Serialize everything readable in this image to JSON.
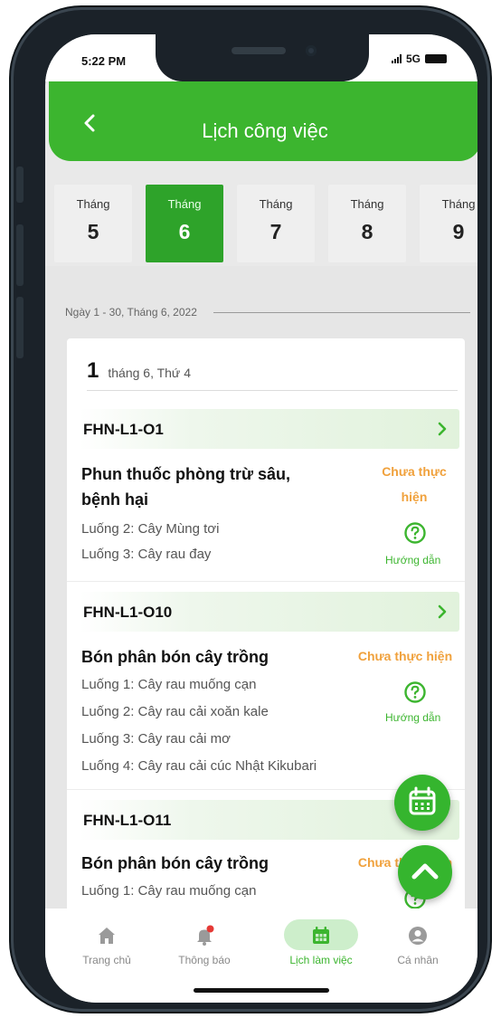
{
  "status_bar": {
    "time": "5:22 PM",
    "network": "5G"
  },
  "header": {
    "title": "Lịch công việc",
    "back_icon": "chevron-left-icon"
  },
  "months": [
    {
      "label": "Tháng",
      "number": "5",
      "active": false
    },
    {
      "label": "Tháng",
      "number": "6",
      "active": true
    },
    {
      "label": "Tháng",
      "number": "7",
      "active": false
    },
    {
      "label": "Tháng",
      "number": "8",
      "active": false
    },
    {
      "label": "Tháng",
      "number": "9",
      "active": false
    }
  ],
  "range_text": "Ngày 1 - 30, Tháng 6, 2022",
  "day": {
    "number": "1",
    "text": "tháng 6,  Thứ 4"
  },
  "plots": [
    {
      "code": "FHN-L1-O1",
      "task": {
        "title_lines": [
          "Phun thuốc phòng trừ sâu,",
          "bệnh hại"
        ],
        "status_lines": [
          "Chưa thực",
          "hiện"
        ],
        "help_label": "Hướng dẫn"
      },
      "lanes": [
        "Luống 2: Cây Mùng tơi",
        "Luống 3: Cây rau đay"
      ]
    },
    {
      "code": "FHN-L1-O10",
      "task": {
        "title_lines": [
          "Bón phân bón cây trồng"
        ],
        "status_lines": [
          "Chưa thực hiện"
        ],
        "help_label": "Hướng dẫn"
      },
      "lanes": [
        "Luống 1: Cây rau muống cạn",
        "Luống 2: Cây rau cải xoăn kale",
        "Luống 3: Cây rau cải mơ",
        "Luống 4: Cây rau cải cúc Nhật Kikubari"
      ]
    },
    {
      "code": "FHN-L1-O11",
      "task": {
        "title_lines": [
          "Bón phân bón cây trồng"
        ],
        "status_lines": [
          "Chưa thực hiện"
        ],
        "help_label": "Hướng dẫn"
      },
      "lanes": [
        "Luống 1: Cây rau muống cạn"
      ]
    }
  ],
  "tabs": [
    {
      "label": "Trang chủ",
      "icon": "home-icon",
      "active": false
    },
    {
      "label": "Thông báo",
      "icon": "bell-icon",
      "active": false,
      "badge_color": "#e53935"
    },
    {
      "label": "Lịch làm việc",
      "icon": "calendar-icon",
      "active": true
    },
    {
      "label": "Cá nhân",
      "icon": "user-icon",
      "active": false
    }
  ],
  "colors": {
    "primary_green": "#3cb52f",
    "status_orange": "#f0a13c",
    "text_dark": "#111111"
  }
}
